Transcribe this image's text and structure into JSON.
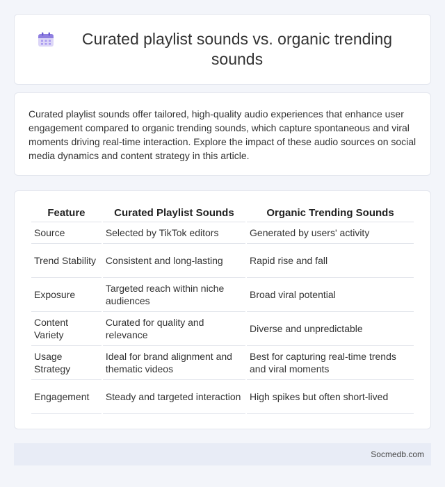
{
  "header": {
    "title": "Curated playlist sounds vs. organic trending sounds",
    "icon": "calendar-icon"
  },
  "intro": {
    "text": "Curated playlist sounds offer tailored, high-quality audio experiences that enhance user engagement compared to organic trending sounds, which capture spontaneous and viral moments driving real-time interaction. Explore the impact of these audio sources on social media dynamics and content strategy in this article."
  },
  "table": {
    "headers": [
      "Feature",
      "Curated Playlist Sounds",
      "Organic Trending Sounds"
    ],
    "rows": [
      [
        "Source",
        "Selected by TikTok editors",
        "Generated by users' activity"
      ],
      [
        "Trend Stability",
        "Consistent and long-lasting",
        "Rapid rise and fall"
      ],
      [
        "Exposure",
        "Targeted reach within niche audiences",
        "Broad viral potential"
      ],
      [
        "Content Variety",
        "Curated for quality and relevance",
        "Diverse and unpredictable"
      ],
      [
        "Usage Strategy",
        "Ideal for brand alignment and thematic videos",
        "Best for capturing real-time trends and viral moments"
      ],
      [
        "Engagement",
        "Steady and targeted interaction",
        "High spikes but often short-lived"
      ]
    ]
  },
  "footer": {
    "site": "Socmedb.com"
  }
}
